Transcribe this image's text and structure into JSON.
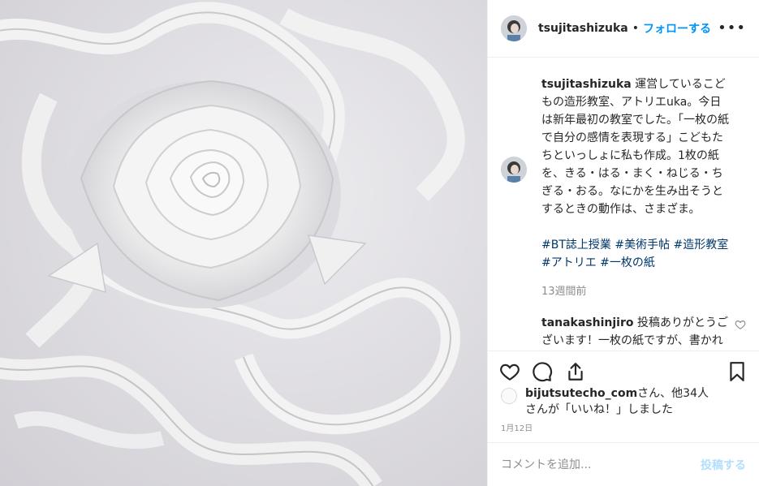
{
  "post": {
    "username": "tsujitashizuka",
    "follow_label": "フォローする",
    "more_label": "•••",
    "caption_user": "tsujitashizuka",
    "caption_text": "運営しているこどもの造形教室、アトリエuka。今日は新年最初の教室でした。「一枚の紙で自分の感情を表現する」こどもたちといっしょに私も作成。1枚の紙を、きる・はる・まく・ねじる・ちぎる・おる。なにかを生み出そうとするときの動作は、さまざま。",
    "hashtags": "#BT誌上授業 #美術手帖 #造形教室 #アトリエ #一枚の紙",
    "caption_time": "13週間前",
    "comment_user": "tanakashinjiro",
    "comment_text": "投稿ありがとうございます！一枚の紙ですが、書かれてある通り、様々な行為で変容するのが楽しくなります。この作品、素敵ですね！こどもたちの驚",
    "likes_user": "bijutsutecho_com",
    "likes_text_1": "さん、他34人",
    "likes_text_2": "さんが「いいね！」しました",
    "date": "1月12日",
    "comment_placeholder": "コメントを追加...",
    "post_label": "投稿する"
  },
  "colors": {
    "accent": "#0095f6",
    "hashtag": "#00376b",
    "muted": "#8e8e8e",
    "post_disabled": "#b2dffc"
  },
  "icons": {
    "heart": "heart-icon",
    "comment": "comment-icon",
    "share": "share-icon",
    "save": "bookmark-icon",
    "more": "more-icon"
  }
}
